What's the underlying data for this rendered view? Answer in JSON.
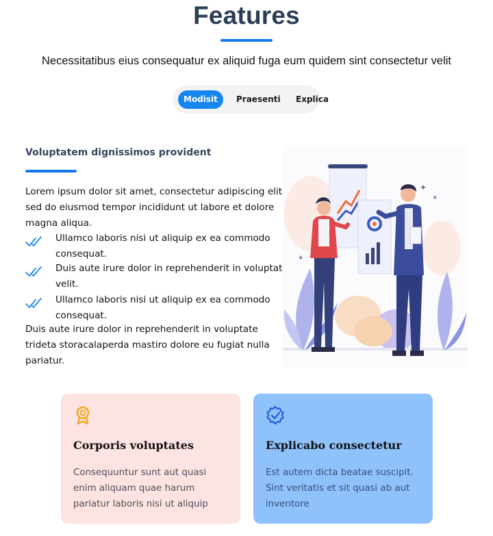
{
  "header": {
    "title": "Features",
    "subtitle": "Necessitatibus eius consequatur ex aliquid fuga eum quidem sint consectetur velit"
  },
  "tabs": [
    {
      "label": "Modisit",
      "active": true
    },
    {
      "label": "Praesenti",
      "active": false
    },
    {
      "label": "Explica",
      "active": false
    }
  ],
  "panel": {
    "title": "Voluptatem dignissimos provident",
    "intro": "Lorem ipsum dolor sit amet, consectetur adipiscing elit, sed do eiusmod tempor incididunt ut labore et dolore magna aliqua.",
    "checklist": [
      "Ullamco laboris nisi ut aliquip ex ea commodo consequat.",
      "Duis aute irure dolor in reprehenderit in voluptate velit.",
      "Ullamco laboris nisi ut aliquip ex ea commodo consequat."
    ],
    "outro": "Duis aute irure dolor in reprehenderit in voluptate trideta storacalaperda mastiro dolore eu fugiat nulla pariatur.",
    "illustration": "business-presentation-illustration"
  },
  "cards": [
    {
      "icon": "award-icon",
      "icon_color": "#f5a623",
      "title": "Corporis voluptates",
      "text": "Consequuntur sunt aut quasi enim aliquam quae harum pariatur laboris nisi ut aliquip",
      "bg": "#fde3e2"
    },
    {
      "icon": "verified-badge-icon",
      "icon_color": "#1a56db",
      "title": "Explicabo consectetur",
      "text": "Est autem dicta beatae suscipit. Sint veritatis et sit quasi ab aut inventore",
      "bg": "#8fc1fb"
    }
  ],
  "colors": {
    "accent": "#1478ec",
    "heading": "#2c3e55",
    "check": "#1e86f0"
  }
}
